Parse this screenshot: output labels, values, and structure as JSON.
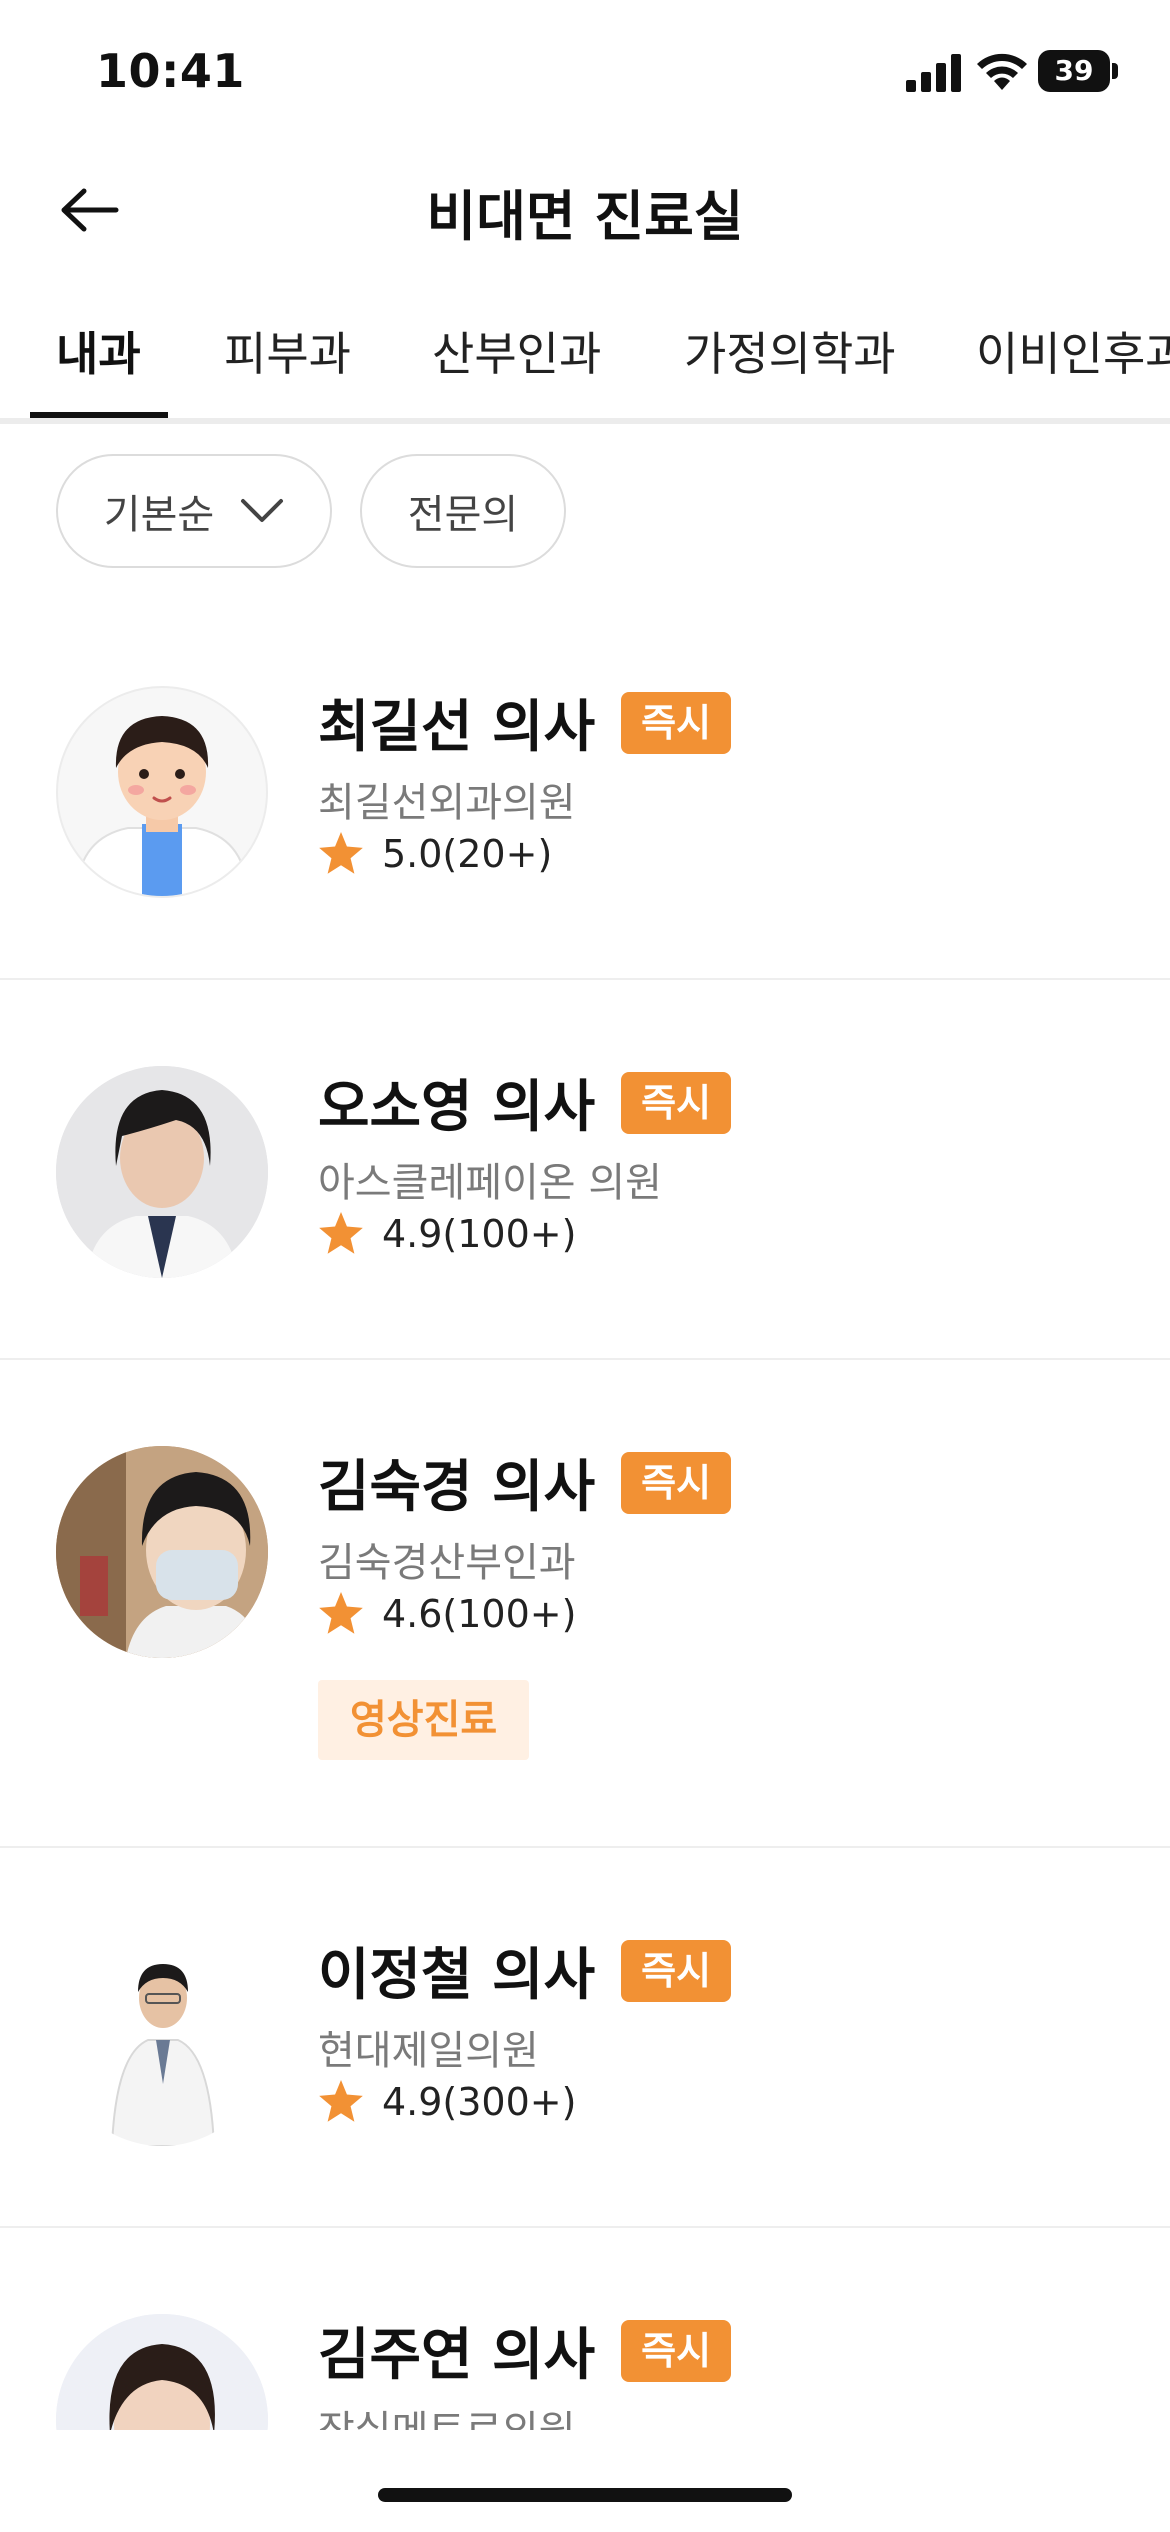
{
  "status_bar": {
    "time": "10:41",
    "battery": "39"
  },
  "header": {
    "title": "비대면 진료실"
  },
  "tabs": [
    {
      "label": "내과",
      "active": true
    },
    {
      "label": "피부과",
      "active": false
    },
    {
      "label": "산부인과",
      "active": false
    },
    {
      "label": "가정의학과",
      "active": false
    },
    {
      "label": "이비인후과",
      "active": false
    }
  ],
  "filters": {
    "sort_label": "기본순",
    "specialist_label": "전문의"
  },
  "doctors": [
    {
      "name": "최길선 의사",
      "badge": "즉시",
      "clinic": "최길선외과의원",
      "rating": "5.0(20+)"
    },
    {
      "name": "오소영 의사",
      "badge": "즉시",
      "clinic": "아스클레페이온 의원",
      "rating": "4.9(100+)"
    },
    {
      "name": "김숙경 의사",
      "badge": "즉시",
      "clinic": "김숙경산부인과",
      "rating": "4.6(100+)",
      "tag": "영상진료"
    },
    {
      "name": "이정철 의사",
      "badge": "즉시",
      "clinic": "현대제일의원",
      "rating": "4.9(300+)"
    },
    {
      "name": "김주연 의사",
      "badge": "즉시",
      "clinic": "잠실메트로의원",
      "rating": ""
    }
  ],
  "colors": {
    "accent": "#f29134",
    "accent_light": "#fff0e3",
    "divider": "#eeeeee"
  }
}
